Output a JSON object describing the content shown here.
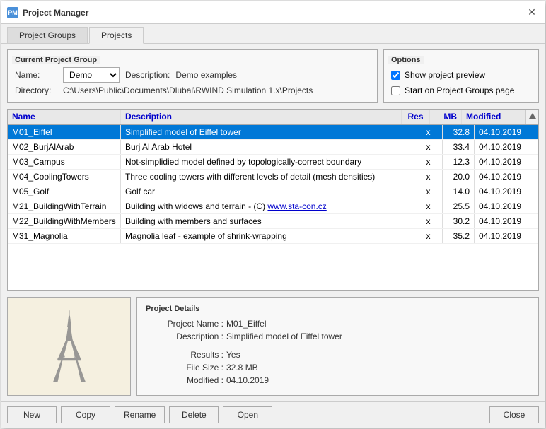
{
  "window": {
    "title": "Project Manager",
    "close_label": "✕",
    "icon": "PM"
  },
  "tabs": [
    {
      "id": "project-groups",
      "label": "Project Groups"
    },
    {
      "id": "projects",
      "label": "Projects"
    }
  ],
  "active_tab": "projects",
  "current_project_group": {
    "section_title": "Current Project Group",
    "name_label": "Name:",
    "name_value": "Demo",
    "description_label": "Description:",
    "description_value": "Demo examples",
    "directory_label": "Directory:",
    "directory_value": "C:\\Users\\Public\\Documents\\Dlubal\\RWIND Simulation 1.x\\Projects"
  },
  "options": {
    "section_title": "Options",
    "show_preview_label": "Show project preview",
    "show_preview_checked": true,
    "start_on_groups_label": "Start on Project Groups page",
    "start_on_groups_checked": false
  },
  "table": {
    "columns": [
      {
        "id": "name",
        "label": "Name"
      },
      {
        "id": "description",
        "label": "Description"
      },
      {
        "id": "res",
        "label": "Res"
      },
      {
        "id": "mb",
        "label": "MB"
      },
      {
        "id": "modified",
        "label": "Modified"
      }
    ],
    "rows": [
      {
        "name": "M01_Eiffel",
        "description": "Simplified model of Eiffel tower",
        "res": "x",
        "mb": "32.8",
        "modified": "04.10.2019",
        "selected": true
      },
      {
        "name": "M02_BurjAlArab",
        "description": "Burj Al Arab Hotel",
        "res": "x",
        "mb": "33.4",
        "modified": "04.10.2019",
        "selected": false
      },
      {
        "name": "M03_Campus",
        "description": "Not-simplidied model defined by topologically-correct boundary",
        "res": "x",
        "mb": "12.3",
        "modified": "04.10.2019",
        "selected": false
      },
      {
        "name": "M04_CoolingTowers",
        "description": "Three cooling towers with different levels of detail (mesh densities)",
        "res": "x",
        "mb": "20.0",
        "modified": "04.10.2019",
        "selected": false
      },
      {
        "name": "M05_Golf",
        "description": "Golf car",
        "res": "x",
        "mb": "14.0",
        "modified": "04.10.2019",
        "selected": false
      },
      {
        "name": "M21_BuildingWithTerrain",
        "description": "Building with widows and terrain - (C) www.sta-con.cz",
        "res": "x",
        "mb": "25.5",
        "modified": "04.10.2019",
        "selected": false
      },
      {
        "name": "M22_BuildingWithMembers",
        "description": "Building with members and surfaces",
        "res": "x",
        "mb": "30.2",
        "modified": "04.10.2019",
        "selected": false
      },
      {
        "name": "M31_Magnolia",
        "description": "Magnolia leaf - example of shrink-wrapping",
        "res": "x",
        "mb": "35.2",
        "modified": "04.10.2019",
        "selected": false
      }
    ]
  },
  "project_details": {
    "section_title": "Project Details",
    "project_name_label": "Project Name :",
    "project_name_value": "M01_Eiffel",
    "description_label": "Description :",
    "description_value": "Simplified model of Eiffel tower",
    "results_label": "Results :",
    "results_value": "Yes",
    "file_size_label": "File Size :",
    "file_size_value": "32.8 MB",
    "modified_label": "Modified :",
    "modified_value": "04.10.2019"
  },
  "buttons": {
    "new": "New",
    "copy": "Copy",
    "rename": "Rename",
    "delete": "Delete",
    "open": "Open",
    "close": "Close"
  }
}
